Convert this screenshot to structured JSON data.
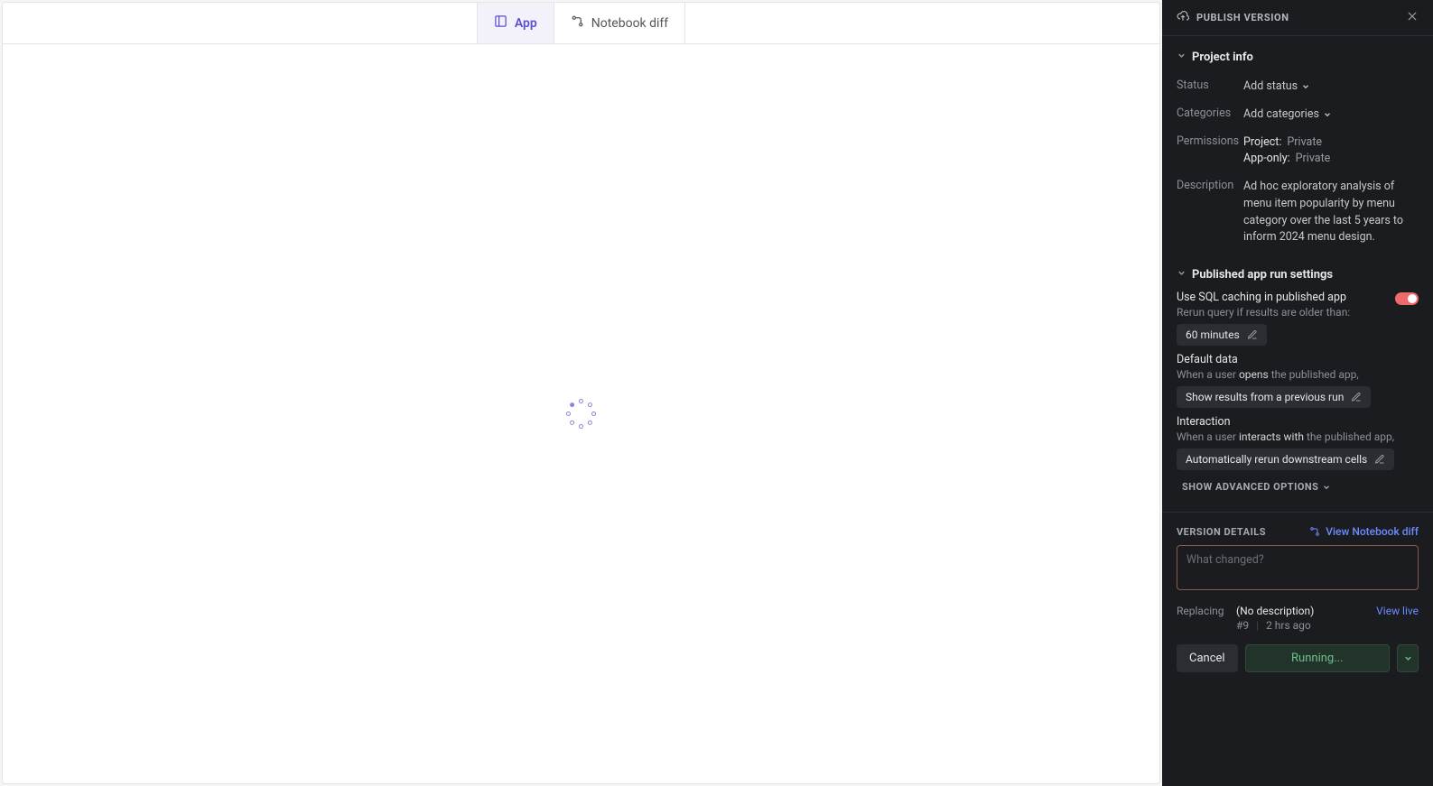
{
  "tabs": {
    "app": "App",
    "notebook_diff": "Notebook diff"
  },
  "panel": {
    "title": "PUBLISH VERSION",
    "project_info": {
      "heading": "Project info",
      "status_label": "Status",
      "status_action": "Add status",
      "categories_label": "Categories",
      "categories_action": "Add categories",
      "permissions_label": "Permissions",
      "perm_project_key": "Project:",
      "perm_project_val": "Private",
      "perm_apponly_key": "App-only:",
      "perm_apponly_val": "Private",
      "description_label": "Description",
      "description_value": "Ad hoc exploratory analysis of menu item popularity by menu category over the last 5 years to inform 2024 menu design."
    },
    "run_settings": {
      "heading": "Published app run settings",
      "sql_caching_label": "Use SQL caching in published app",
      "sql_caching_enabled": true,
      "rerun_older_label": "Rerun query if results are older than:",
      "rerun_older_value": "60 minutes",
      "default_data_heading": "Default data",
      "default_data_prefix": "When a user ",
      "default_data_emph": "opens",
      "default_data_suffix": " the published app,",
      "default_data_value": "Show results from a previous run",
      "interaction_heading": "Interaction",
      "interaction_prefix": "When a user ",
      "interaction_emph": "interacts with",
      "interaction_suffix": " the published app,",
      "interaction_value": "Automatically rerun downstream cells",
      "advanced": "SHOW ADVANCED OPTIONS"
    },
    "version_details": {
      "heading": "VERSION DETAILS",
      "view_diff": "View Notebook diff",
      "placeholder": "What changed?",
      "replacing_label": "Replacing",
      "replacing_desc": "(No description)",
      "replacing_version": "#9",
      "replacing_time": "2 hrs ago",
      "view_live": "View live"
    },
    "footer": {
      "cancel": "Cancel",
      "running": "Running..."
    }
  }
}
